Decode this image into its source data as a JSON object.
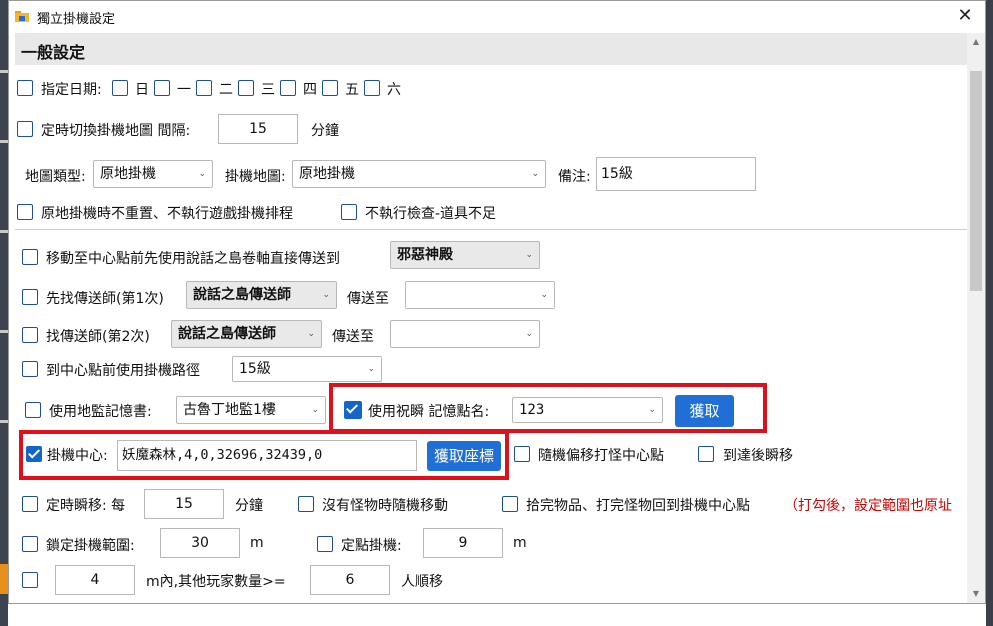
{
  "window": {
    "title": "獨立掛機設定",
    "close_glyph": "✕"
  },
  "section": {
    "title": "一般設定"
  },
  "days": {
    "label": "指定日期:",
    "items": [
      "日",
      "一",
      "二",
      "三",
      "四",
      "五",
      "六"
    ]
  },
  "timed_switch": {
    "label": "定時切換掛機地圖 間隔:",
    "value": "15",
    "unit": "分鐘"
  },
  "map_type": {
    "label": "地圖類型:",
    "value": "原地掛機"
  },
  "hang_map": {
    "label": "掛機地圖:",
    "value": "原地掛機"
  },
  "remark": {
    "label": "備注:",
    "value": "15級"
  },
  "no_reset": {
    "label": "原地掛機時不重置、不執行遊戲掛機排程"
  },
  "no_check": {
    "label": "不執行檢查-道具不足"
  },
  "teleport_scroll": {
    "label": "移動至中心點前先使用說話之島卷軸直接傳送到",
    "value": "邪惡神殿"
  },
  "find_tp1": {
    "label": "先找傳送師(第1次)",
    "value": "說話之島傳送師",
    "dest_label": "傳送至",
    "dest_value": ""
  },
  "find_tp2": {
    "label": "找傳送師(第2次)",
    "value": "說話之島傳送師",
    "dest_label": "傳送至",
    "dest_value": ""
  },
  "route": {
    "label": "到中心點前使用掛機路徑",
    "value": "15級"
  },
  "dungeon_book": {
    "label": "使用地監記憶書:",
    "value": "古魯丁地監1樓"
  },
  "blessing": {
    "label": "使用祝瞬 記憶點名:",
    "value": "123",
    "button": "獲取",
    "checked": true
  },
  "center": {
    "label": "掛機中心:",
    "value": "妖魔森林,4,0,32696,32439,0",
    "button": "獲取座標",
    "checked": true
  },
  "random_offset": {
    "label": "隨機偏移打怪中心點"
  },
  "arrive_teleport": {
    "label": "到達後瞬移"
  },
  "timed_teleport": {
    "label": "定時瞬移: 每",
    "value": "15",
    "unit": "分鐘"
  },
  "no_monster": {
    "label": "沒有怪物時隨機移動"
  },
  "pickup_return": {
    "label": "拾完物品、打完怪物回到掛機中心點",
    "note": "（打勾後，設定範圍也原址"
  },
  "lock_range": {
    "label": "鎖定掛機範圍:",
    "value": "30",
    "unit": "m"
  },
  "fixed_point": {
    "label": "定點掛機:",
    "value": "9",
    "unit": "m"
  },
  "players": {
    "value1": "4",
    "mid": "m內,其他玩家數量>=",
    "value2": "6",
    "suffix": "人順移"
  },
  "colors": {
    "accent": "#1f6fd6",
    "highlight": "#e0101a",
    "note": "#d40000"
  }
}
